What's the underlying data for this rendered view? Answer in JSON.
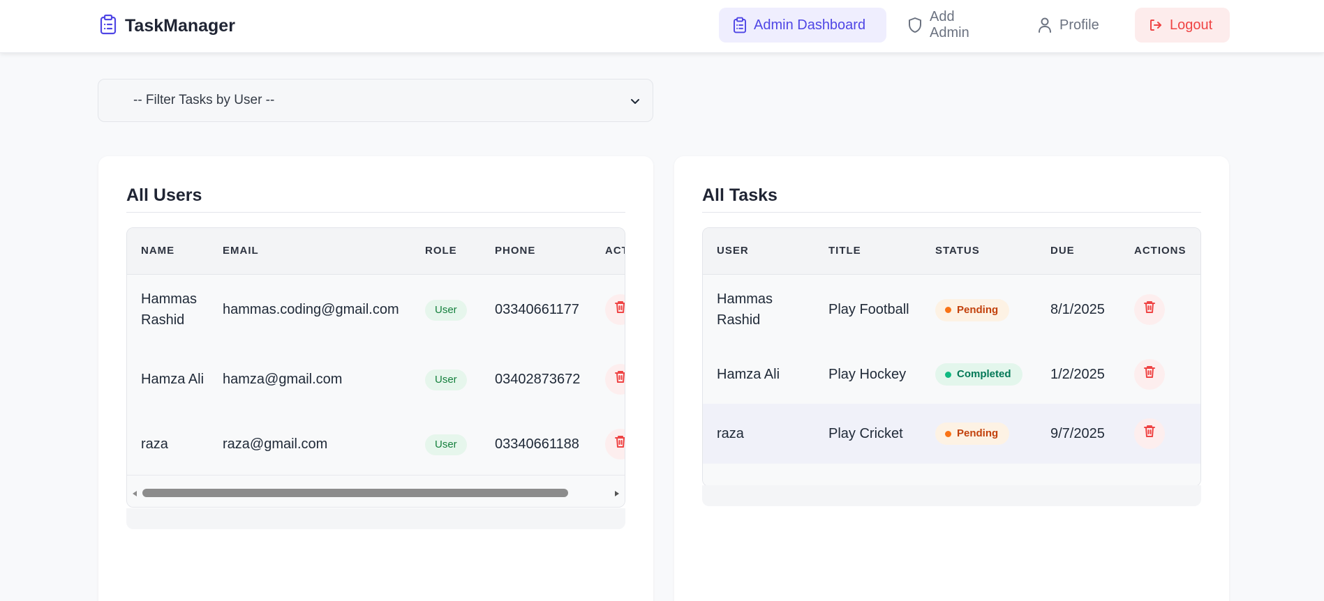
{
  "app": {
    "name": "TaskManager"
  },
  "nav": {
    "items": [
      {
        "label": "Admin Dashboard",
        "icon": "clipboard-icon",
        "active": true
      },
      {
        "label": "Add Admin",
        "icon": "shield-icon"
      },
      {
        "label": "Profile",
        "icon": "user-icon"
      },
      {
        "label": "Logout",
        "icon": "logout-icon"
      }
    ]
  },
  "filter": {
    "selected": "-- Filter Tasks by User --"
  },
  "users_card": {
    "title": "All Users",
    "columns": [
      "NAME",
      "EMAIL",
      "ROLE",
      "PHONE",
      "ACTIONS"
    ],
    "rows": [
      {
        "name": "Hammas Rashid",
        "email": "hammas.coding@gmail.com",
        "role": "User",
        "phone": "03340661177"
      },
      {
        "name": "Hamza Ali",
        "email": "hamza@gmail.com",
        "role": "User",
        "phone": "03402873672"
      },
      {
        "name": "raza",
        "email": "raza@gmail.com",
        "role": "User",
        "phone": "03340661188"
      }
    ]
  },
  "tasks_card": {
    "title": "All Tasks",
    "columns": [
      "USER",
      "TITLE",
      "STATUS",
      "DUE",
      "ACTIONS"
    ],
    "rows": [
      {
        "user": "Hammas Rashid",
        "title": "Play Football",
        "status": "Pending",
        "due": "8/1/2025"
      },
      {
        "user": "Hamza Ali",
        "title": "Play Hockey",
        "status": "Completed",
        "due": "1/2/2025"
      },
      {
        "user": "raza",
        "title": "Play Cricket",
        "status": "Pending",
        "due": "9/7/2025"
      }
    ]
  },
  "colors": {
    "accent": "#4f46e5",
    "danger": "#ef4444",
    "pending": "#f97316",
    "completed": "#10b981"
  }
}
